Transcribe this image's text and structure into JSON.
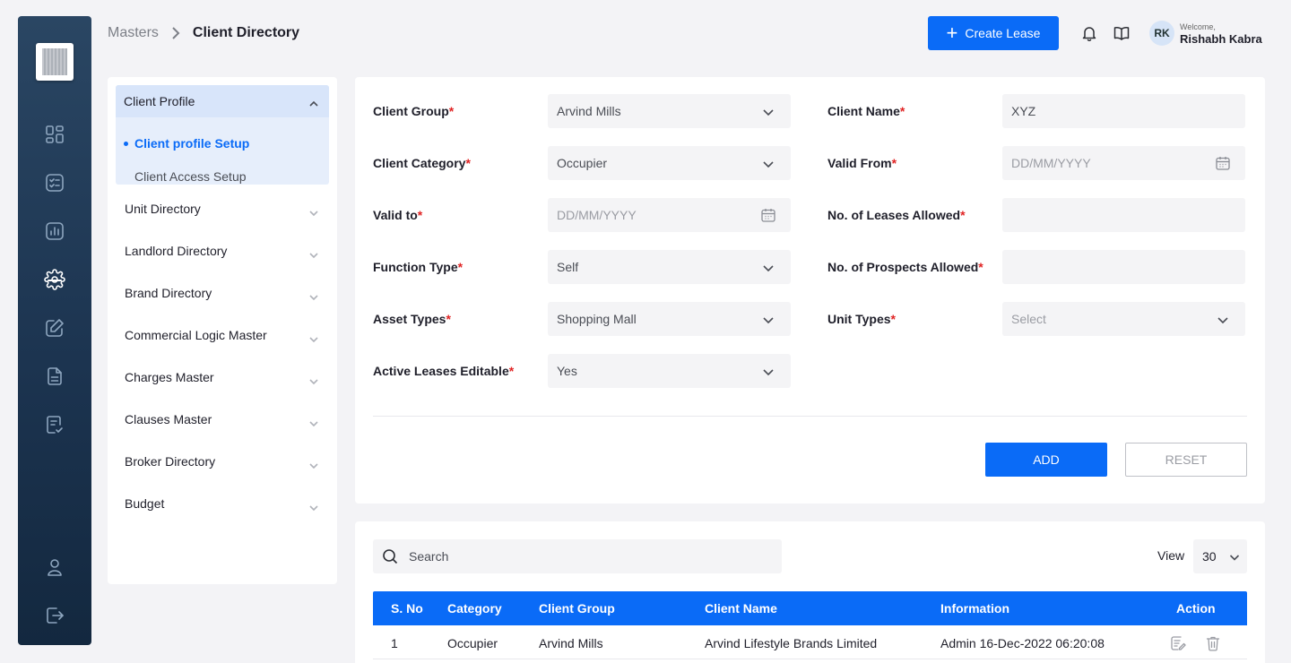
{
  "breadcrumb": {
    "parent": "Masters",
    "current": "Client Directory"
  },
  "header": {
    "create_label": "Create Lease",
    "avatar_initials": "RK",
    "welcome": "Welcome,",
    "user_name": "Rishabh Kabra"
  },
  "leftnav": {
    "group_title": "Client Profile",
    "sub_items": [
      "Client profile Setup",
      "Client Access Setup"
    ],
    "items": [
      "Unit Directory",
      "Landlord Directory",
      "Brand Directory",
      "Commercial Logic Master",
      "Charges Master",
      "Clauses Master",
      "Broker Directory",
      "Budget"
    ]
  },
  "form": {
    "client_group": {
      "label": "Client Group",
      "value": "Arvind Mills"
    },
    "client_name": {
      "label": "Client Name",
      "value": "XYZ"
    },
    "client_category": {
      "label": "Client Category",
      "value": "Occupier"
    },
    "valid_from": {
      "label": "Valid From",
      "placeholder": "DD/MM/YYYY"
    },
    "valid_to": {
      "label": "Valid to",
      "placeholder": "DD/MM/YYYY"
    },
    "leases_allowed": {
      "label": "No. of Leases Allowed",
      "value": ""
    },
    "function_type": {
      "label": "Function Type",
      "value": "Self"
    },
    "prospects_allowed": {
      "label": "No. of Prospects Allowed",
      "value": ""
    },
    "asset_types": {
      "label": "Asset Types",
      "value": "Shopping Mall"
    },
    "unit_types": {
      "label": "Unit Types",
      "placeholder": "Select"
    },
    "active_leases_editable": {
      "label": "Active Leases Editable",
      "value": "Yes"
    },
    "required_mark": "*",
    "add_label": "ADD",
    "reset_label": "RESET"
  },
  "table": {
    "search_placeholder": "Search",
    "view_label": "View",
    "view_value": "30",
    "columns": [
      "S. No",
      "Category",
      "Client Group",
      "Client Name",
      "Information",
      "Action"
    ],
    "rows": [
      [
        "1",
        "Occupier",
        "Arvind Mills",
        "Arvind Lifestyle Brands Limited",
        "Admin 16-Dec-2022 06:20:08"
      ]
    ]
  },
  "colors": {
    "accent": "#0a6bf7",
    "rail": "#1c3450",
    "required": "#e02424"
  }
}
